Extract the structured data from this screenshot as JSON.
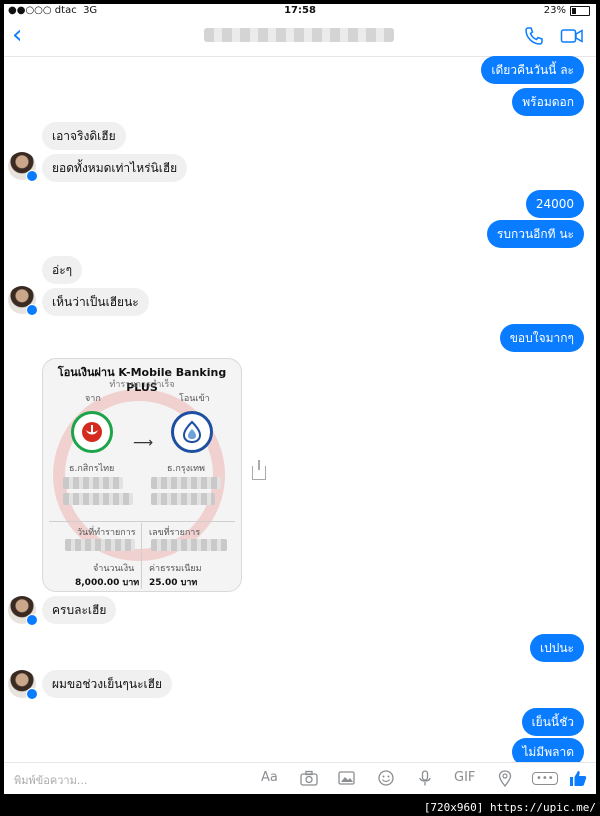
{
  "status": {
    "carrier": "●●○○○ dtac",
    "network": "3G",
    "time": "17:58",
    "battery": "23%",
    "battery_level": 0.23
  },
  "nav": {
    "back": "‹"
  },
  "messages": [
    {
      "side": "mine",
      "text": "เดียวคืนวันนี้ ละ"
    },
    {
      "side": "mine",
      "text": "พร้อมดอก"
    },
    {
      "side": "theirs",
      "text": "เอาจริงดิเฮีย"
    },
    {
      "side": "theirs",
      "text": "ยอดทั้งหมดเท่าไหร่นิเฮีย"
    },
    {
      "side": "mine",
      "text": "24000"
    },
    {
      "side": "mine",
      "text": "รบกวนอีกที นะ"
    },
    {
      "side": "theirs",
      "text": "อ่ะๆ"
    },
    {
      "side": "theirs",
      "text": "เห็นว่าเป็นเฮียนะ"
    },
    {
      "side": "mine",
      "text": "ขอบใจมากๆ"
    },
    {
      "side": "theirs",
      "text": "ครบละเฮีย"
    },
    {
      "side": "mine",
      "text": "เปปนะ"
    },
    {
      "side": "theirs",
      "text": "ผมขอช่วงเย็นๆนะเฮีย"
    },
    {
      "side": "mine",
      "text": "เย็นนี้ชัว"
    },
    {
      "side": "mine",
      "text": "ไม่มีพลาด"
    }
  ],
  "receipt": {
    "title": "โอนเงินผ่าน K-Mobile Banking PLUS",
    "subtitle": "ทำรายการสำเร็จ",
    "from_label": "จาก",
    "to_label": "โอนเข้า",
    "from_bank": "ธ.กสิกรไทย",
    "to_bank": "ธ.กรุงเทพ",
    "date_label": "วันที่ทำรายการ",
    "ref_label": "เลขที่รายการ",
    "amount_label": "จำนวนเงิน",
    "fee_label": "ค่าธรรมเนียม",
    "amount": "8,000.00 บาท",
    "fee": "25.00 บาท",
    "colors": {
      "kbank": "#1ba548",
      "bbl": "#1e4fa0"
    }
  },
  "composer": {
    "placeholder": "พิมพ์ข้อความ...",
    "aa": "Aa",
    "gif": "GIF",
    "more": "•••"
  },
  "watermark": "[720x960] https://upic.me/"
}
